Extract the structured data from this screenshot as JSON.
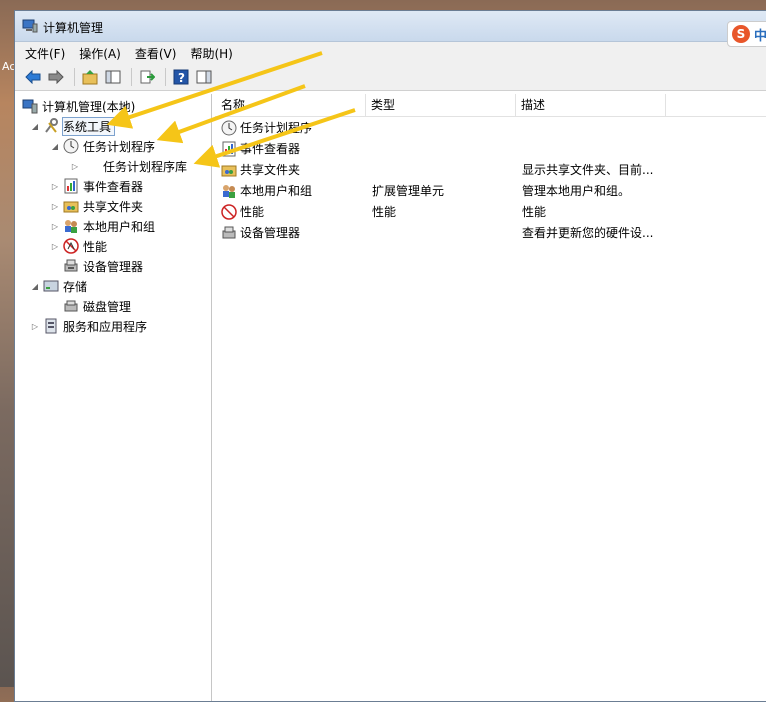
{
  "window": {
    "title": "计算机管理"
  },
  "ime": {
    "s": "S",
    "label": "中"
  },
  "desktop": {
    "edge_text": "Ac"
  },
  "menu": [
    "文件(F)",
    "操作(A)",
    "查看(V)",
    "帮助(H)"
  ],
  "tree": {
    "root": "计算机管理(本地)",
    "system_tools": "系统工具",
    "task_scheduler": "任务计划程序",
    "task_scheduler_library": "任务计划程序库",
    "event_viewer": "事件查看器",
    "shared_folders": "共享文件夹",
    "local_users": "本地用户和组",
    "performance": "性能",
    "device_manager": "设备管理器",
    "storage": "存储",
    "disk_management": "磁盘管理",
    "services_apps": "服务和应用程序"
  },
  "list": {
    "headers": [
      "名称",
      "类型",
      "描述"
    ],
    "rows": [
      {
        "name": "任务计划程序",
        "type": "",
        "desc": "",
        "icon": "clock-icon"
      },
      {
        "name": "事件查看器",
        "type": "",
        "desc": "",
        "icon": "event-viewer-icon"
      },
      {
        "name": "共享文件夹",
        "type": "",
        "desc": "显示共享文件夹、目前...",
        "icon": "shared-folder-icon"
      },
      {
        "name": "本地用户和组",
        "type": "扩展管理单元",
        "desc": "管理本地用户和组。",
        "icon": "users-icon"
      },
      {
        "name": "性能",
        "type": "性能",
        "desc": "性能",
        "icon": "performance-icon"
      },
      {
        "name": "设备管理器",
        "type": "",
        "desc": "查看并更新您的硬件设...",
        "icon": "device-manager-icon"
      }
    ]
  },
  "colors": {
    "arrow": "#f5c518",
    "title_bg": "#d4e2f2",
    "selection": "#7da2ce"
  }
}
